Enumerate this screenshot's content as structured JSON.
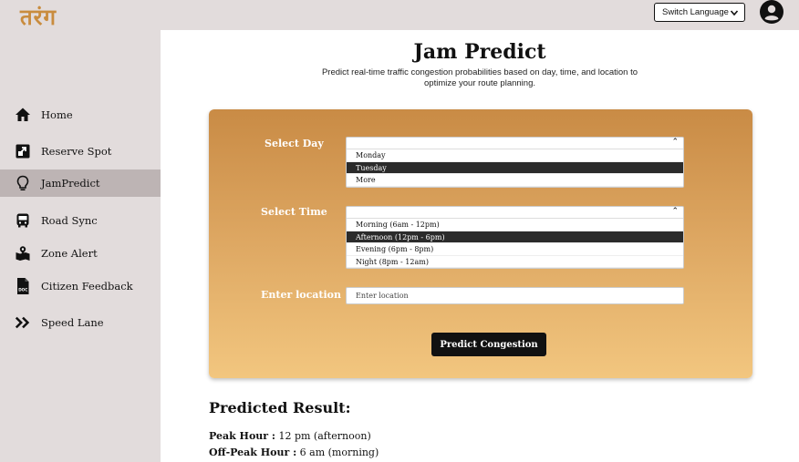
{
  "app": {
    "logo": "तरंग"
  },
  "topbar": {
    "language_button": "Switch Language"
  },
  "sidebar": {
    "items": [
      {
        "label": "Home",
        "icon": "home-icon"
      },
      {
        "label": "Reserve Spot",
        "icon": "reserve-icon"
      },
      {
        "label": "JamPredict",
        "icon": "lightbulb-icon",
        "active": true
      },
      {
        "label": "Road Sync",
        "icon": "bus-icon"
      },
      {
        "label": "Zone Alert",
        "icon": "map-pin-icon"
      },
      {
        "label": "Citizen Feedback",
        "icon": "doc-icon"
      },
      {
        "label": "Speed Lane",
        "icon": "double-chevron-icon"
      }
    ]
  },
  "main": {
    "title": "Jam Predict",
    "subtitle": "Predict real-time traffic congestion probabilities based on day, time, and location to optimize your route planning.",
    "form": {
      "day_label": "Select Day",
      "day_options": [
        "Monday",
        "Tuesday",
        "More"
      ],
      "day_selected": "Tuesday",
      "time_label": "Select Time",
      "time_options": [
        "Morning (6am - 12pm)",
        "Afternoon (12pm - 6pm)",
        "Evening (6pm - 8pm)",
        "Night (8pm - 12am)"
      ],
      "time_selected": "Afternoon (12pm - 6pm)",
      "location_label": "Enter location",
      "location_placeholder": "Enter location",
      "location_value": "",
      "submit_label": "Predict Congestion"
    },
    "result": {
      "title": "Predicted Result:",
      "peak_label": "Peak Hour :",
      "peak_value": " 12 pm (afternoon)",
      "offpeak_label": "Off-Peak Hour :",
      "offpeak_value": " 6 am (morning)"
    }
  },
  "colors": {
    "accent": "#c98b45",
    "accent_light": "#f2c67f",
    "sidebar_bg": "#e2dcdc",
    "active_bg": "#bdb4b4"
  }
}
